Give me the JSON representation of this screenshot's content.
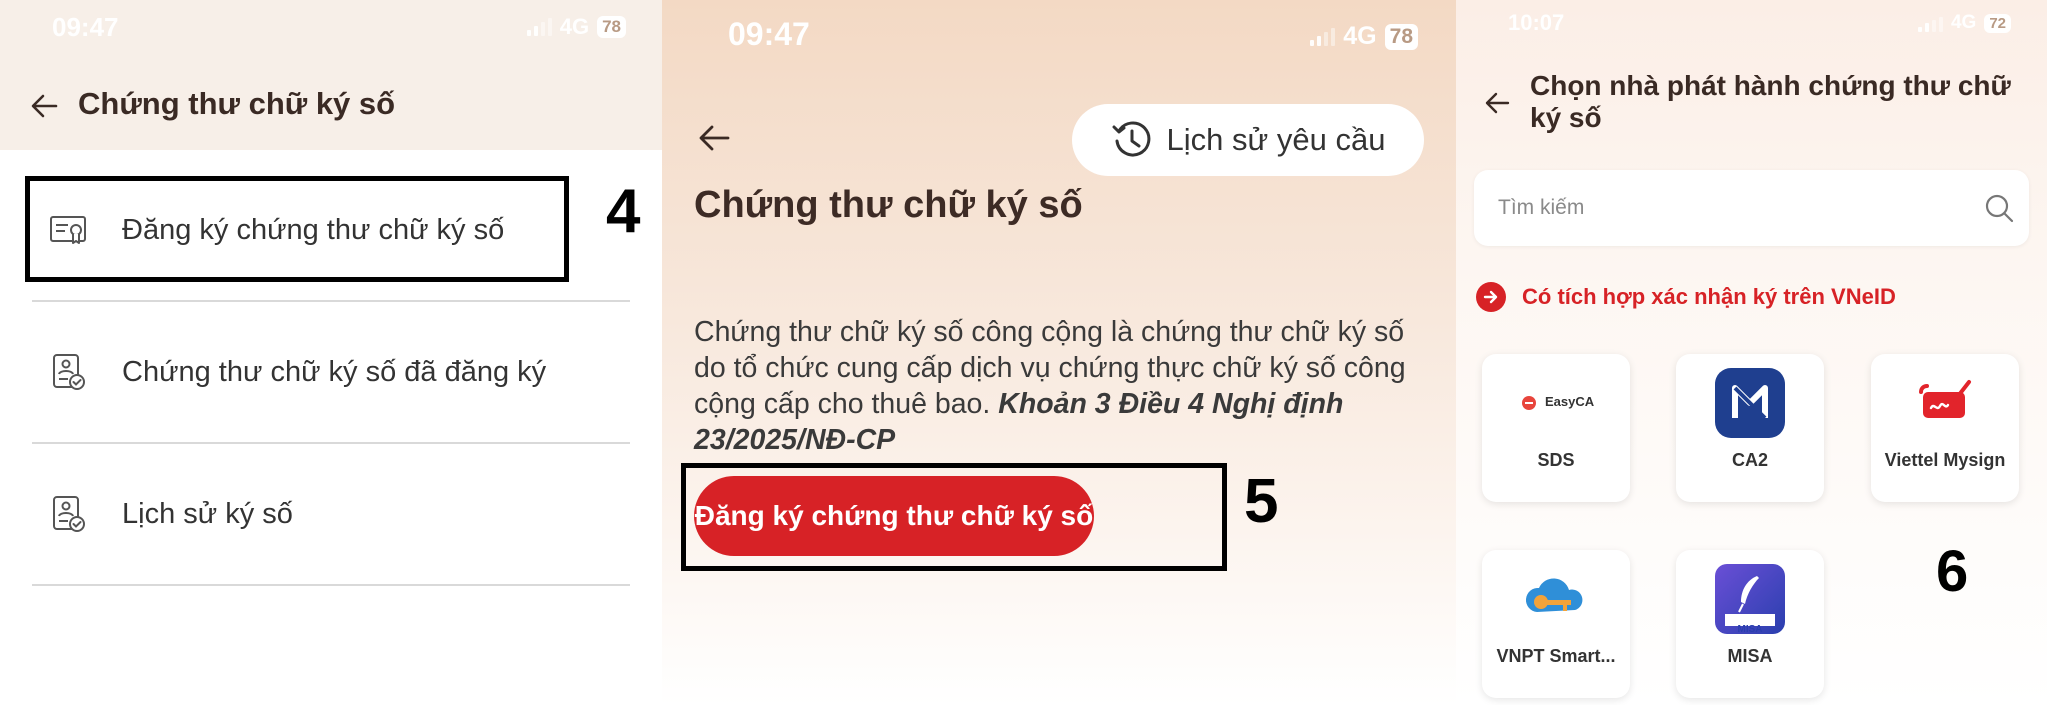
{
  "annotations": {
    "step4": "4",
    "step5": "5",
    "step6": "6"
  },
  "panel1": {
    "status": {
      "time": "09:47",
      "network": "4G",
      "battery": "78"
    },
    "title": "Chứng thư chữ ký số",
    "menu": [
      {
        "label": "Đăng ký chứng thư chữ ký số",
        "icon": "certificate-icon"
      },
      {
        "label": "Chứng thư chữ ký số đã đăng ký",
        "icon": "document-check-icon"
      },
      {
        "label": "Lịch sử ký số",
        "icon": "document-check-icon"
      }
    ]
  },
  "panel2": {
    "status": {
      "time": "09:47",
      "network": "4G",
      "battery": "78"
    },
    "history_button": "Lịch sử yêu cầu",
    "title": "Chứng thư chữ ký số",
    "description": "Chứng thư chữ ký số công cộng là chứng thư chữ ký số do tổ chức cung cấp dịch vụ chứng thực chữ ký số công cộng cấp cho thuê bao. ",
    "description_ref": "Khoản 3 Điều 4 Nghị định 23/2025/NĐ-CP",
    "register_button": "Đăng ký chứng thư chữ ký số"
  },
  "panel3": {
    "status": {
      "time": "10:07",
      "network": "4G",
      "battery": "72"
    },
    "title": "Chọn nhà phát hành chứng thư chữ ký số",
    "search_placeholder": "Tìm kiếm",
    "vneid_label": "Có tích hợp xác nhận ký trên VNeID",
    "providers": [
      {
        "name": "SDS",
        "logo_text": "EasyCA"
      },
      {
        "name": "CA2"
      },
      {
        "name": "Viettel Mysign"
      },
      {
        "name": "VNPT Smart..."
      },
      {
        "name": "MISA",
        "logo_text": "MISA"
      }
    ]
  },
  "colors": {
    "accent": "#d72226",
    "annotation": "#000000",
    "text": "#333333"
  }
}
